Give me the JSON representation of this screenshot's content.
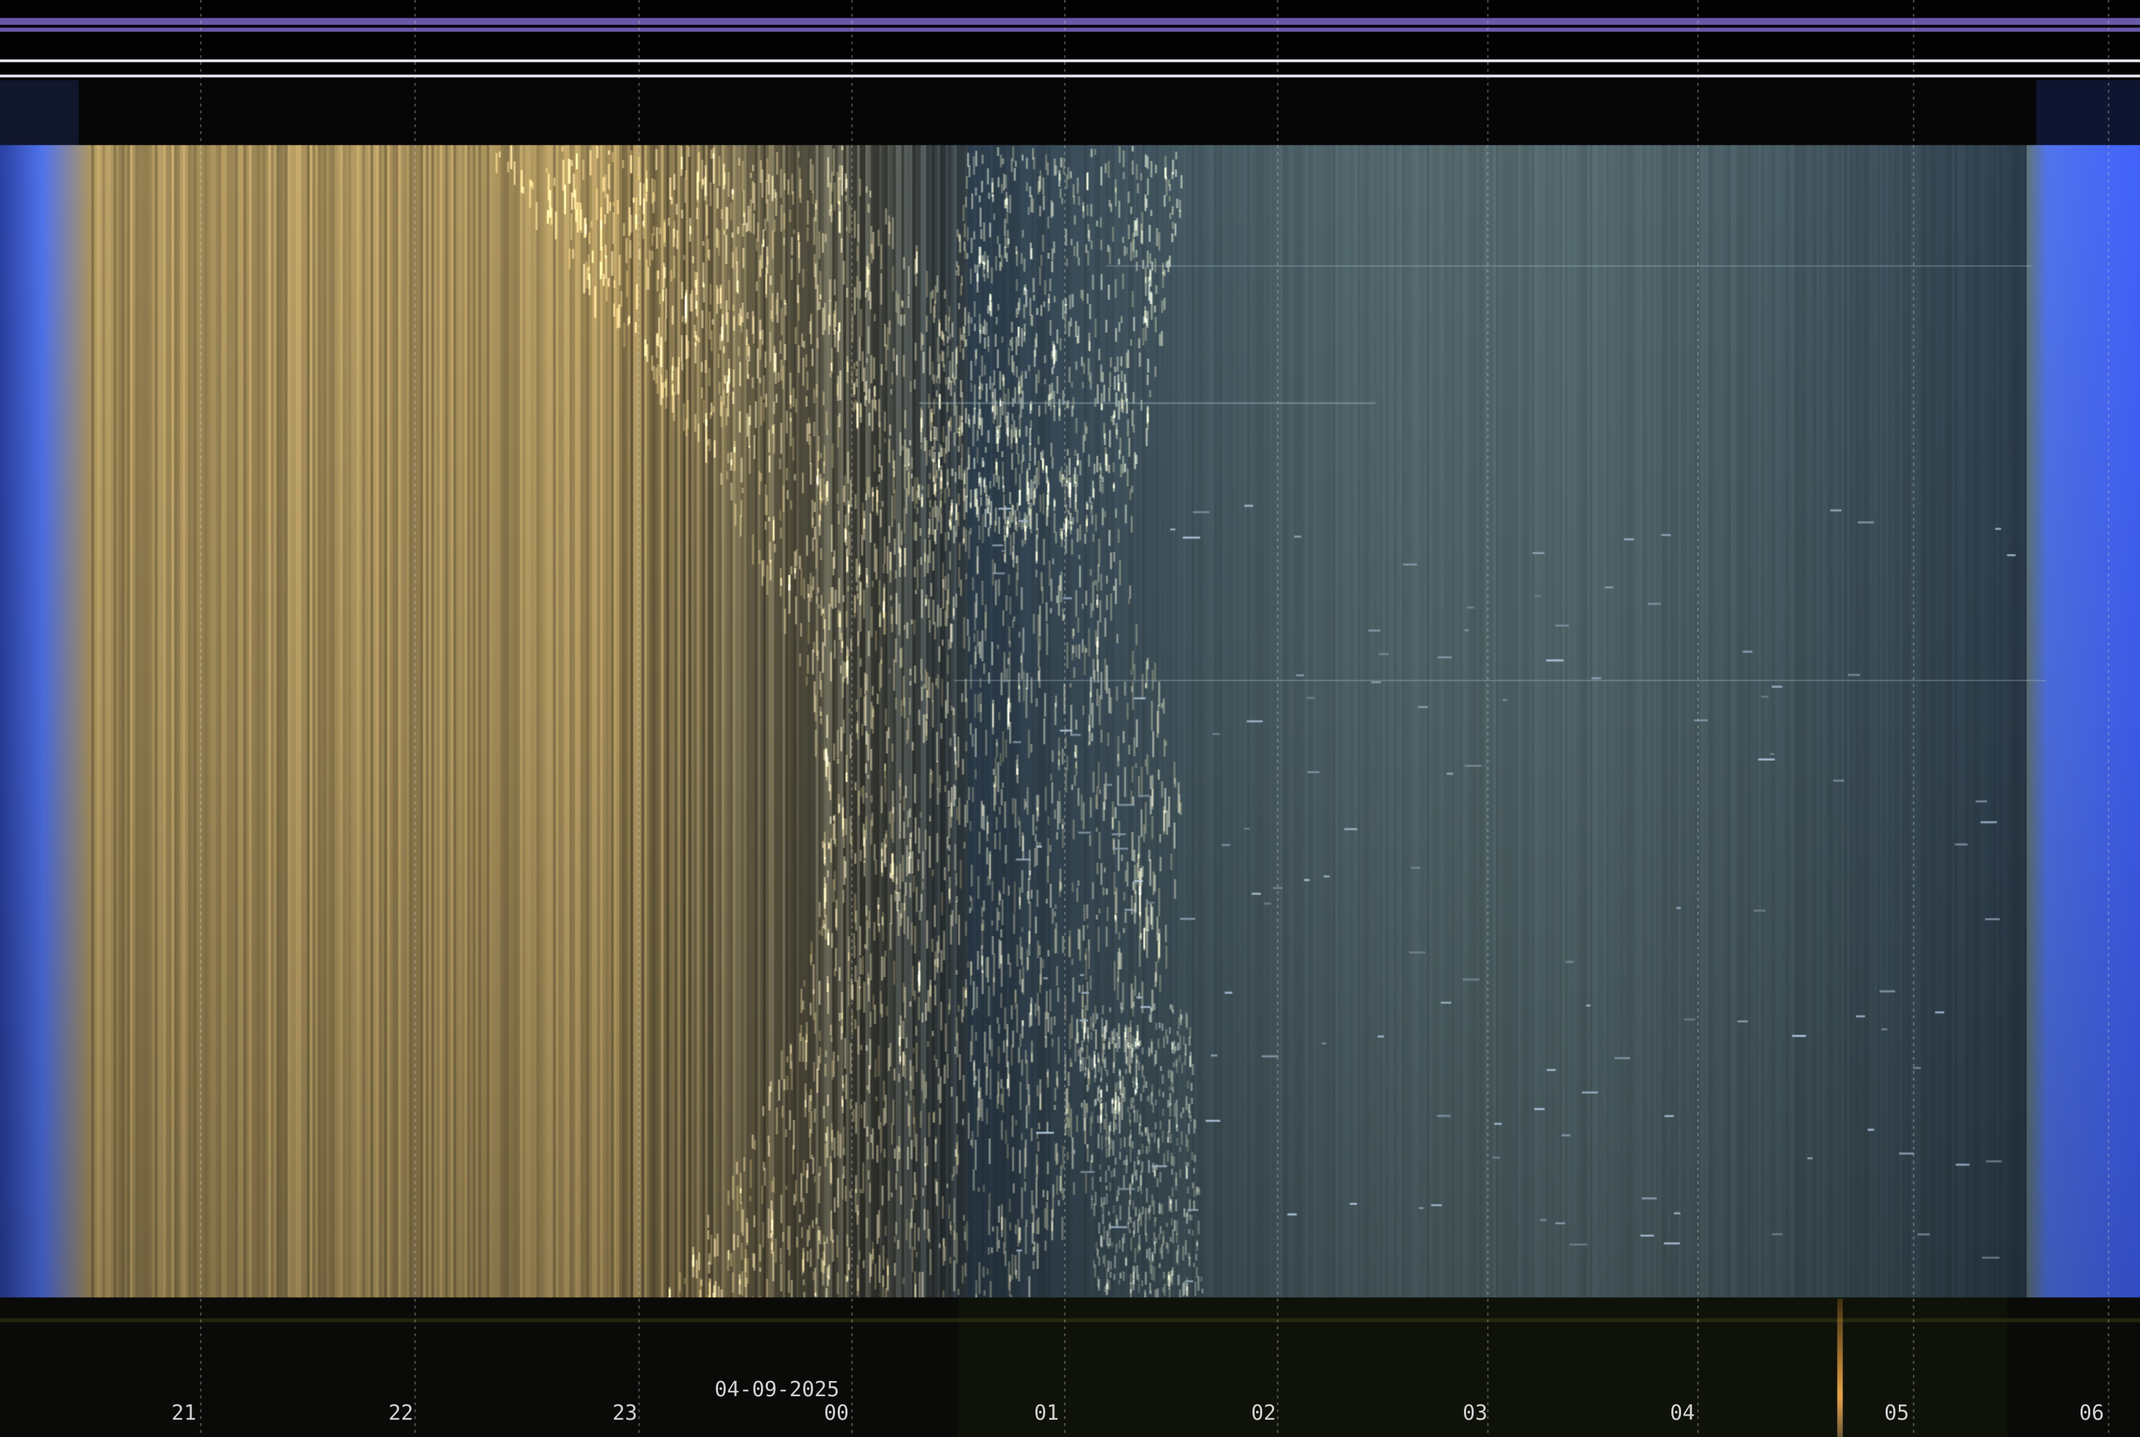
{
  "keogram": {
    "date_label": "04-09-2025",
    "hour_labels": [
      "21",
      "22",
      "23",
      "00",
      "01",
      "02",
      "03",
      "04",
      "05",
      "06"
    ],
    "colors": {
      "header_bar": "#6a58a8",
      "header_lines": "#e8e8f0",
      "twilight_blue": "#4a6ad8",
      "moonlight_gold": "#a08a58",
      "night_sky": "#2a3a48",
      "label_text": "#d2d2d2",
      "grid_line": "#c8c8c8"
    }
  }
}
